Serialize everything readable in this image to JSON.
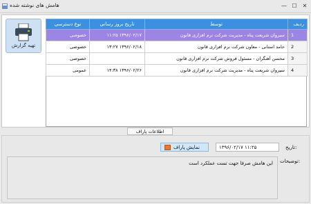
{
  "window": {
    "title": "هامش های نوشته شده",
    "minimize_glyph": "—",
    "maximize_glyph": "☐",
    "close_glyph": "✕"
  },
  "report_button": {
    "label": "تهیه گزارش",
    "icon": "printer-icon"
  },
  "table": {
    "columns": [
      "ردیف",
      "توسط",
      "تاریخ بروز رسانی",
      "نوع دسترسی"
    ],
    "rows": [
      {
        "num": "1",
        "by": "سیروان شریعت پناه - مدیریت شرکت نرم افزاری قانون",
        "date": "۱۳۹۶/۰۲/۱۷ ۱۱:۲۵",
        "access": "خصوصی",
        "selected": true
      },
      {
        "num": "2",
        "by": "حامد استانی - معاون شرکت نرم افزاری قانون",
        "date": "۱۳۹۶/۰۲/۱۸ ۱۳:۲۷",
        "access": "خصوصی"
      },
      {
        "num": "3",
        "by": "محسن آهنگران - مسئول فروش شرکت نرم افزاری قانون",
        "date": "",
        "access": "خصوصی"
      },
      {
        "num": "4",
        "by": "سیروان شریعت پناه - مدیریت شرکت نرم افزاری قانون",
        "date": "۱۳۹۶/۰۲/۲۶ ۱۴:۳۸",
        "access": "عمومی"
      }
    ]
  },
  "details_tab": {
    "label": "اطلاعات پاراف"
  },
  "details": {
    "date_label": "تاریخ:",
    "date_value": "۱۳۹۶/۰۲/۱۷ ۱۱:۲۵",
    "show_attachment_label": "نمایش پاراف",
    "description_label": "توضیحات:",
    "description_value": "این هامش صرفا جهت تست عملکرد است"
  },
  "colors": {
    "header": "#3d8fe0",
    "selected_row": "#9d85e6",
    "button_bg": "#cfe0f3"
  }
}
